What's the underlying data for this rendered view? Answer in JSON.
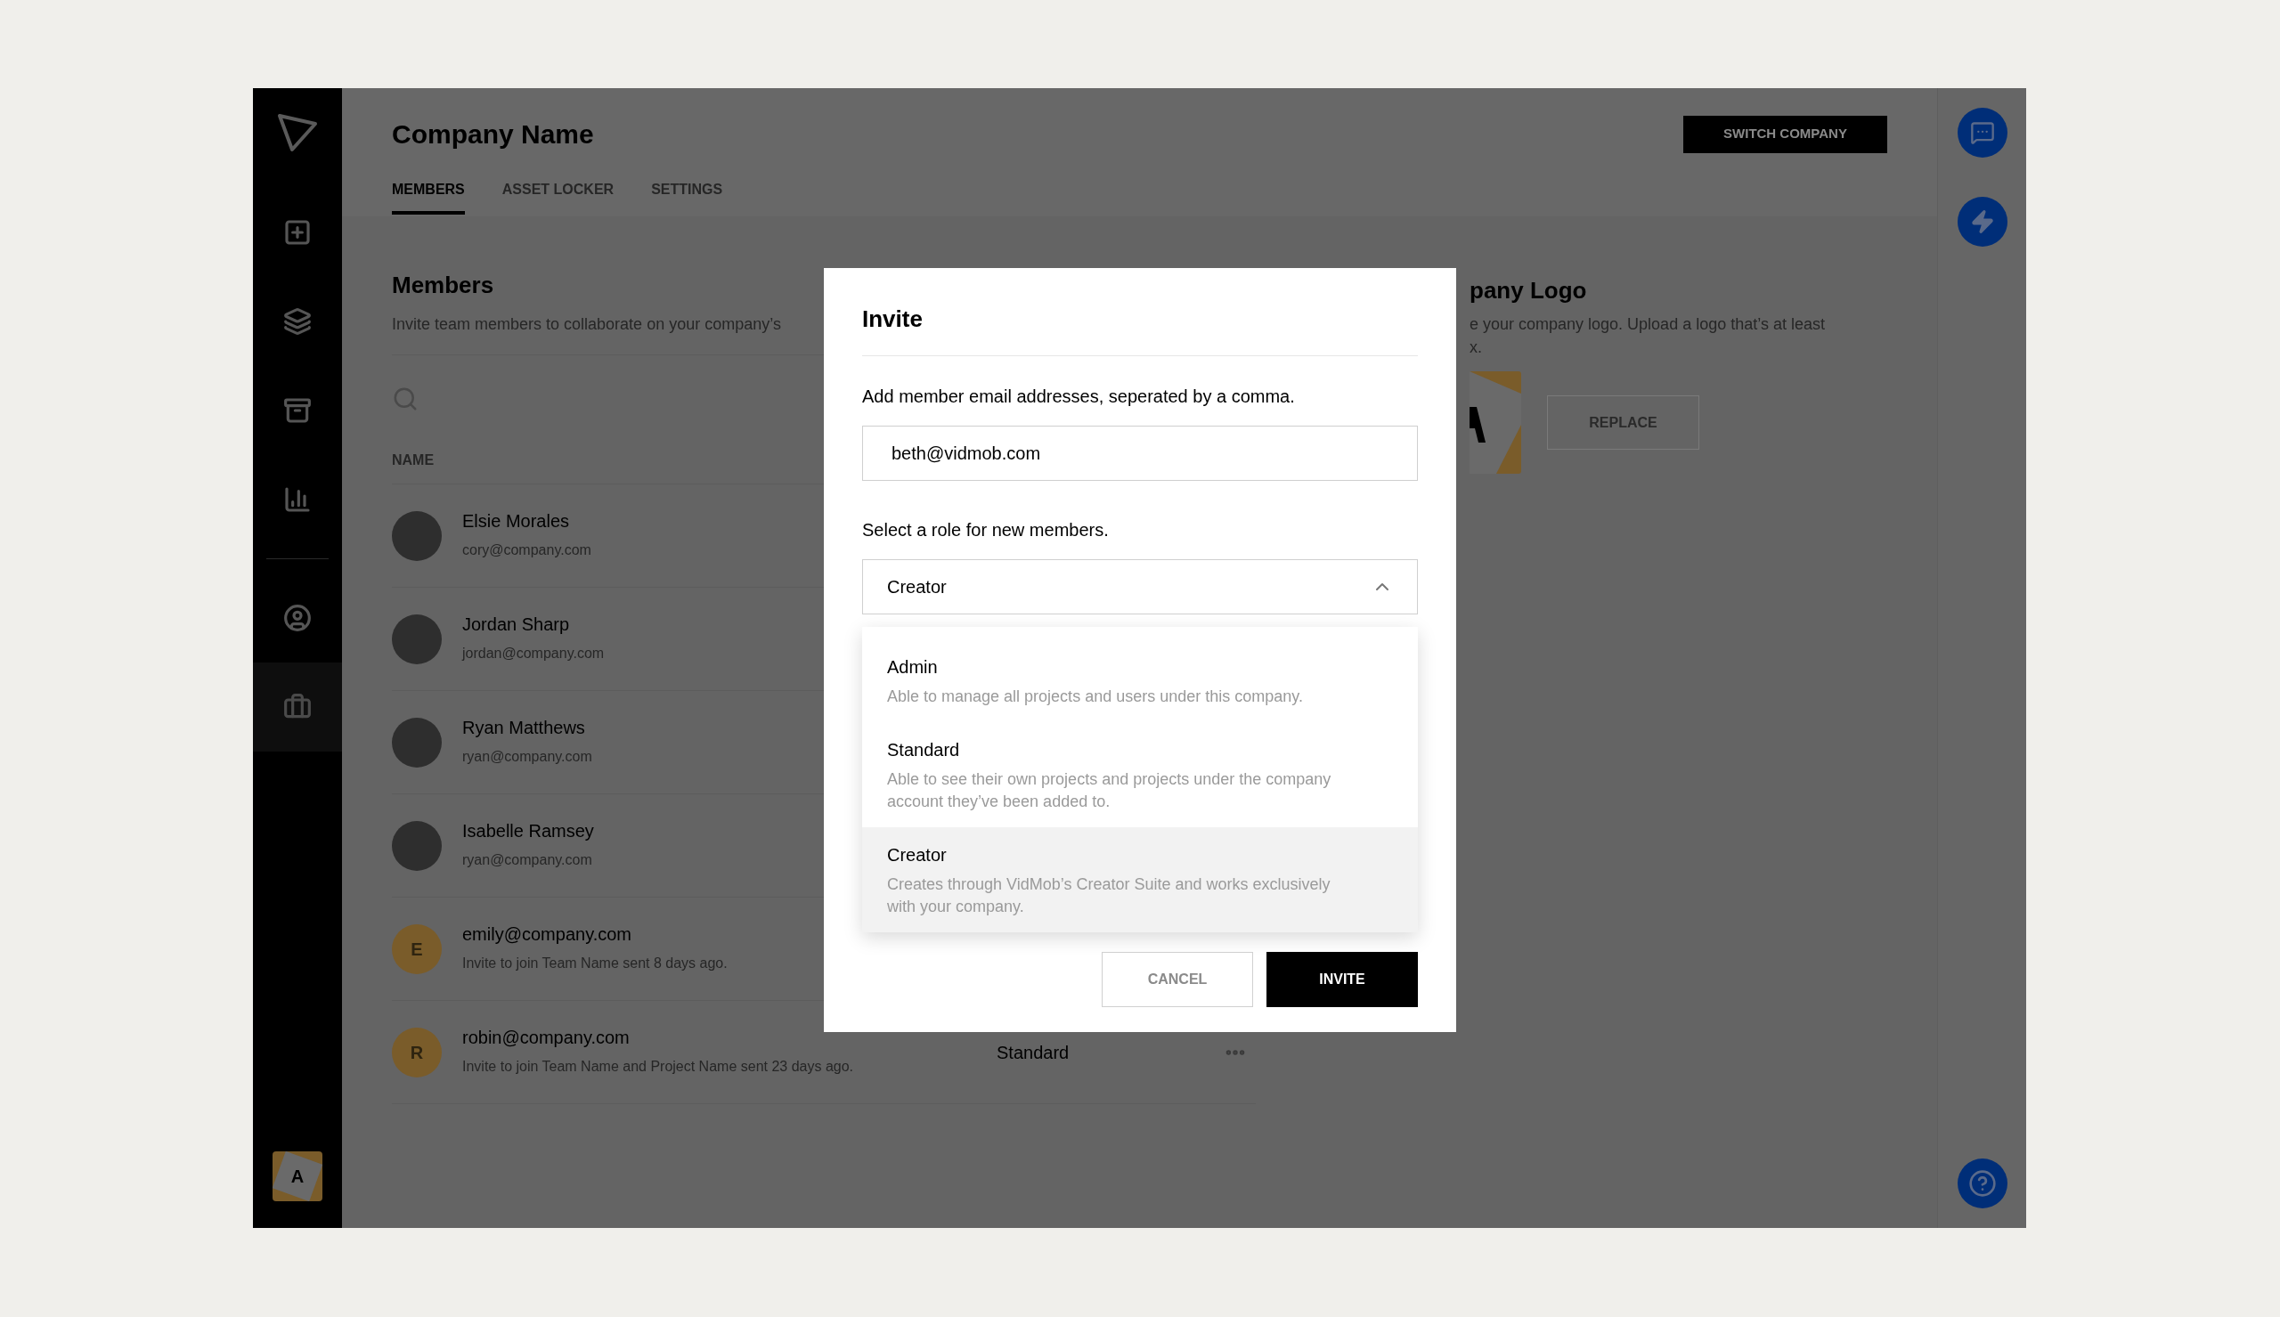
{
  "sidebar": {
    "items": [
      {
        "selected": false
      },
      {
        "selected": false
      },
      {
        "selected": false
      },
      {
        "selected": false
      },
      {
        "selected": false
      },
      {
        "selected": true
      }
    ],
    "account_badge": "A"
  },
  "header": {
    "title": "Company Name",
    "switch_button": "SWITCH COMPANY"
  },
  "tabs": [
    {
      "label": "MEMBERS",
      "selected": true
    },
    {
      "label": "ASSET LOCKER",
      "selected": false
    },
    {
      "label": "SETTINGS",
      "selected": false
    }
  ],
  "members_section": {
    "title": "Members",
    "description": "Invite team members to collaborate on your company’s",
    "column_name": "NAME",
    "rows": [
      {
        "kind": "photo",
        "name": "Elsie Morales",
        "detail": "cory@company.com"
      },
      {
        "kind": "photo",
        "name": "Jordan Sharp",
        "detail": "jordan@company.com"
      },
      {
        "kind": "photo",
        "name": "Ryan Matthews",
        "detail": "ryan@company.com"
      },
      {
        "kind": "photo",
        "name": "Isabelle Ramsey",
        "detail": "ryan@company.com"
      },
      {
        "kind": "invite",
        "initial": "E",
        "name": "emily@company.com",
        "detail": "Invite to join Team Name sent 8 days ago."
      },
      {
        "kind": "invite",
        "initial": "R",
        "name": "robin@company.com",
        "detail": "Invite to join Team Name and Project Name sent 23 days ago.",
        "role": "Standard"
      }
    ]
  },
  "logo_section": {
    "title": "pany Logo",
    "description": [
      "e your company logo. Upload a logo that’s at least",
      "x."
    ],
    "replace_button": "REPLACE"
  },
  "invite_dialog": {
    "title": "Invite",
    "email_label": "Add member email addresses, seperated by a comma.",
    "email_value": "beth@vidmob.com",
    "role_label": "Select a role for new members.",
    "role_value": "Creator",
    "role_options": [
      {
        "name": "Admin",
        "description": "Able to manage all projects and users under this company.",
        "selected": false
      },
      {
        "name": "Standard",
        "description": "Able to see their own projects and projects under the company account they’ve been added to.",
        "selected": false
      },
      {
        "name": "Creator",
        "description": "Creates through VidMob’s Creator Suite and works exclusively with your company.",
        "selected": true
      }
    ],
    "cancel_button": "CANCEL",
    "invite_button": "INVITE"
  }
}
